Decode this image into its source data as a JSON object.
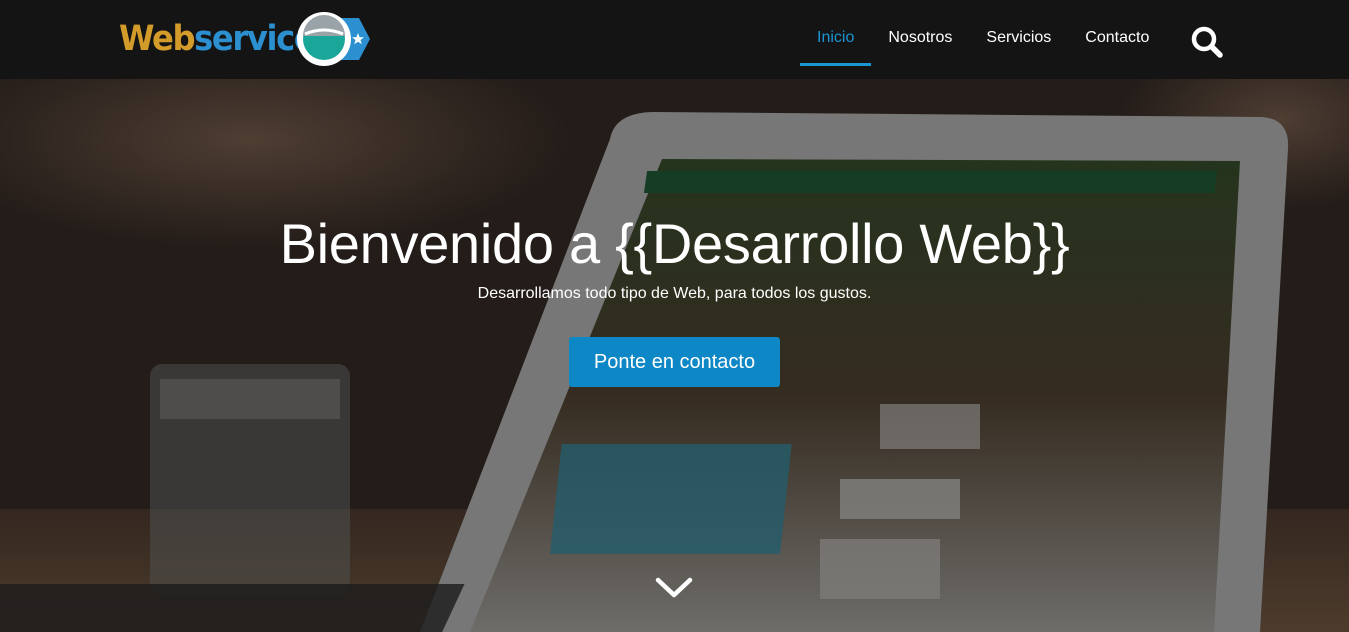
{
  "brand": {
    "logo_part1": "Web",
    "logo_part2": "service",
    "colors": {
      "web": "#d39b2a",
      "service": "#2b8fd0",
      "badge": "#2b8fd0",
      "ring_teal": "#1aa79a"
    }
  },
  "nav": {
    "items": [
      {
        "label": "Inicio",
        "active": true
      },
      {
        "label": "Nosotros",
        "active": false
      },
      {
        "label": "Servicios",
        "active": false
      },
      {
        "label": "Contacto",
        "active": false
      }
    ],
    "search_icon": "search-icon",
    "accent": "#1a95d3"
  },
  "hero": {
    "title": "Bienvenido a {{Desarrollo Web}}",
    "subtitle": "Desarrollamos todo tipo de Web, para todos los gustos.",
    "cta_label": "Ponte en contacto",
    "cta_color": "#0d87c5",
    "scroll_icon": "chevron-down-icon"
  }
}
